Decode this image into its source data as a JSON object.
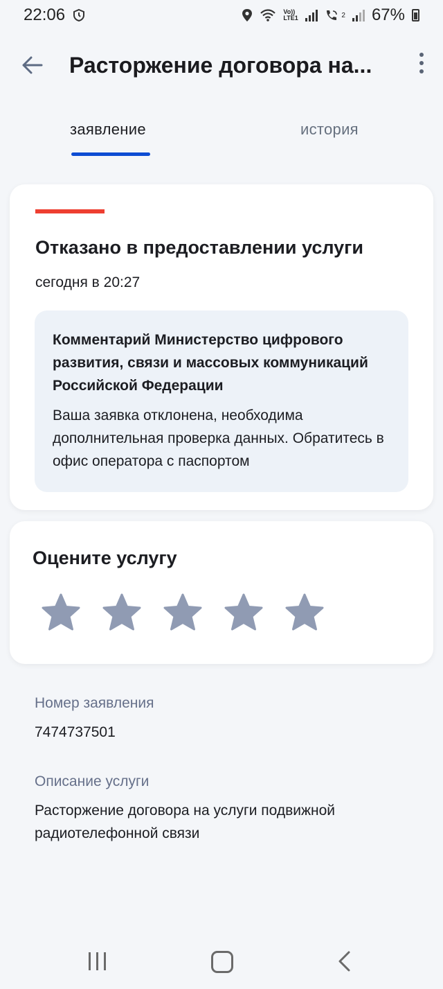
{
  "status_bar": {
    "time": "22:06",
    "battery": "67%",
    "volte_label": "Vo)) LTE1",
    "sim2_label": "2"
  },
  "app_bar": {
    "title": "Расторжение договора на..."
  },
  "tabs": [
    {
      "label": "заявление",
      "active": true
    },
    {
      "label": "история",
      "active": false
    }
  ],
  "status_card": {
    "title": "Отказано в предоставлении услуги",
    "time": "сегодня в 20:27",
    "comment_title": "Комментарий Министерство цифрового развития, связи и массовых коммуникаций Российской Федерации",
    "comment_text": "Ваша заявка отклонена, необходима дополнительная проверка данных. Обратитесь в офис оператора с паспортом",
    "accent_color": "#ee3f31"
  },
  "rating": {
    "title": "Оцените услугу",
    "stars_total": 5,
    "star_color": "#909bb3"
  },
  "details": {
    "number_label": "Номер заявления",
    "number_value": "7474737501",
    "description_label": "Описание услуги",
    "description_value": "Расторжение договора на услуги подвижной радиотелефонной связи"
  },
  "colors": {
    "tab_indicator": "#0d4cd3",
    "comment_bg": "#edf2f8"
  }
}
